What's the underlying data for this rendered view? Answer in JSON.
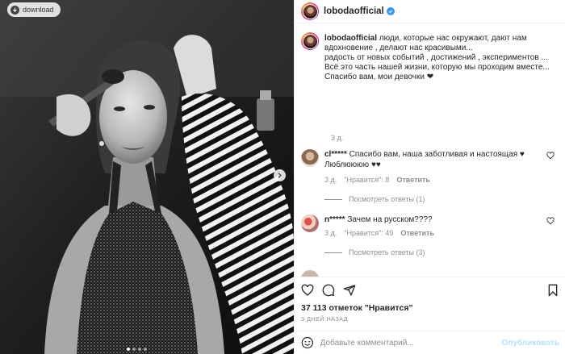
{
  "download_label": "download",
  "post": {
    "username": "lobodaofficial",
    "caption_lines": [
      "люди, которые нас окружают, дают нам",
      "вдохновение , делают нас красивыми...",
      "радость от новых событий , достижений , экспериментов ...",
      "Всё это часть нашей жизни, которую мы проходим вместе...",
      "Спасибо вам, мои девочки ❤"
    ],
    "caption_time": "3 д."
  },
  "comments": [
    {
      "username": "cl*****",
      "text_line1": "Спасибо вам, наша заботливая и настоящая ♥",
      "text_line2": "Люблюююю ♥♥",
      "time": "3 д.",
      "likes": "\"Нравится\": 8",
      "reply_label": "Ответить",
      "view_replies": "Посмотреть ответы (1)"
    },
    {
      "username": "n*****",
      "text_line1": "Зачем на русском????",
      "text_line2": "",
      "time": "3 д.",
      "likes": "\"Нравится\": 49",
      "reply_label": "Ответить",
      "view_replies": "Посмотреть ответы (3)"
    }
  ],
  "likes_count": "37 113 отметок \"Нравится\"",
  "post_date": "3 ДНЕЙ НАЗАД",
  "comment_input": {
    "placeholder": "Добавьте комментарий...",
    "publish_label": "Опубликовать"
  },
  "carousel": {
    "total": 4,
    "active": 1
  },
  "icons": [
    "verified-icon",
    "heart-icon",
    "comment-icon",
    "share-icon",
    "save-icon",
    "emoji-icon",
    "chevron-right-icon",
    "download-icon"
  ],
  "colors": {
    "accent": "#3897f0",
    "muted": "#8e8e8e",
    "publish_disabled": "#b2dffc",
    "like_red": "#ed4956"
  }
}
